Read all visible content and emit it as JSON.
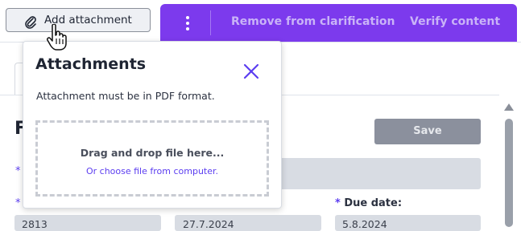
{
  "toolbar": {
    "add_attachment_label": "Add attachment",
    "remove_from_clarification_label": "Remove from clarification",
    "verify_content_label": "Verify content"
  },
  "form": {
    "title_visible": "F",
    "save_label": "Save",
    "due_date_label": "Due date:",
    "fields": {
      "number_value": "2813",
      "date_value": "27.7.2024",
      "due_date_value": "5.8.2024"
    }
  },
  "popup": {
    "title": "Attachments",
    "note": "Attachment must be in PDF format.",
    "drop_main": "Drag and drop file here...",
    "drop_sub": "Or choose file from computer."
  },
  "colors": {
    "accent": "#7c3aed",
    "link": "#5b3df0",
    "save_disabled": "#8b909d"
  },
  "icons": {
    "paperclip": "paperclip-icon",
    "more": "more-vertical-icon",
    "close": "close-icon",
    "cursor": "hand-pointer-cursor"
  }
}
